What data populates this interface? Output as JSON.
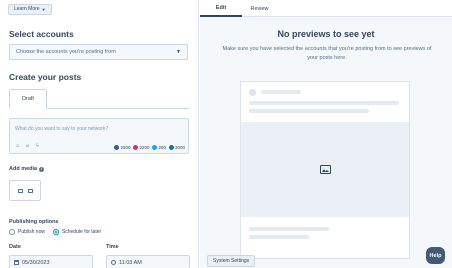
{
  "header": {
    "learn_more_label": "Learn More"
  },
  "accounts": {
    "heading": "Select accounts",
    "select_placeholder": "Choose the accounts you're posting from"
  },
  "create": {
    "heading": "Create your posts",
    "tab_label": "Draft",
    "compose_placeholder": "What do you want to say to your network?",
    "counters": [
      {
        "network": "facebook",
        "value": "2500",
        "color": "#3b5998"
      },
      {
        "network": "instagram",
        "value": "2200",
        "color": "#c13584"
      },
      {
        "network": "twitter",
        "value": "280",
        "color": "#1da1f2"
      },
      {
        "network": "linkedin",
        "value": "3000",
        "color": "#0077b5"
      }
    ]
  },
  "media": {
    "heading": "Add media"
  },
  "publishing": {
    "heading": "Publishing options",
    "option_now": "Publish now",
    "option_later": "Schedule for later",
    "selected": "Schedule for later",
    "date_label": "Date",
    "date_value": "05/30/2023",
    "time_label": "Time",
    "time_value": "11:03 AM"
  },
  "preview": {
    "tabs": [
      "Edit",
      "Review"
    ],
    "active_tab": "Edit",
    "title": "No previews to see yet",
    "message": "Make sure you have selected the accounts that you're posting from to see previews of your posts here."
  },
  "footer": {
    "system_settings_label": "System Settings",
    "help_label": "Help"
  },
  "colors": {
    "accent": "#0091ae",
    "text": "#33475b",
    "help_bg": "#425b76"
  }
}
